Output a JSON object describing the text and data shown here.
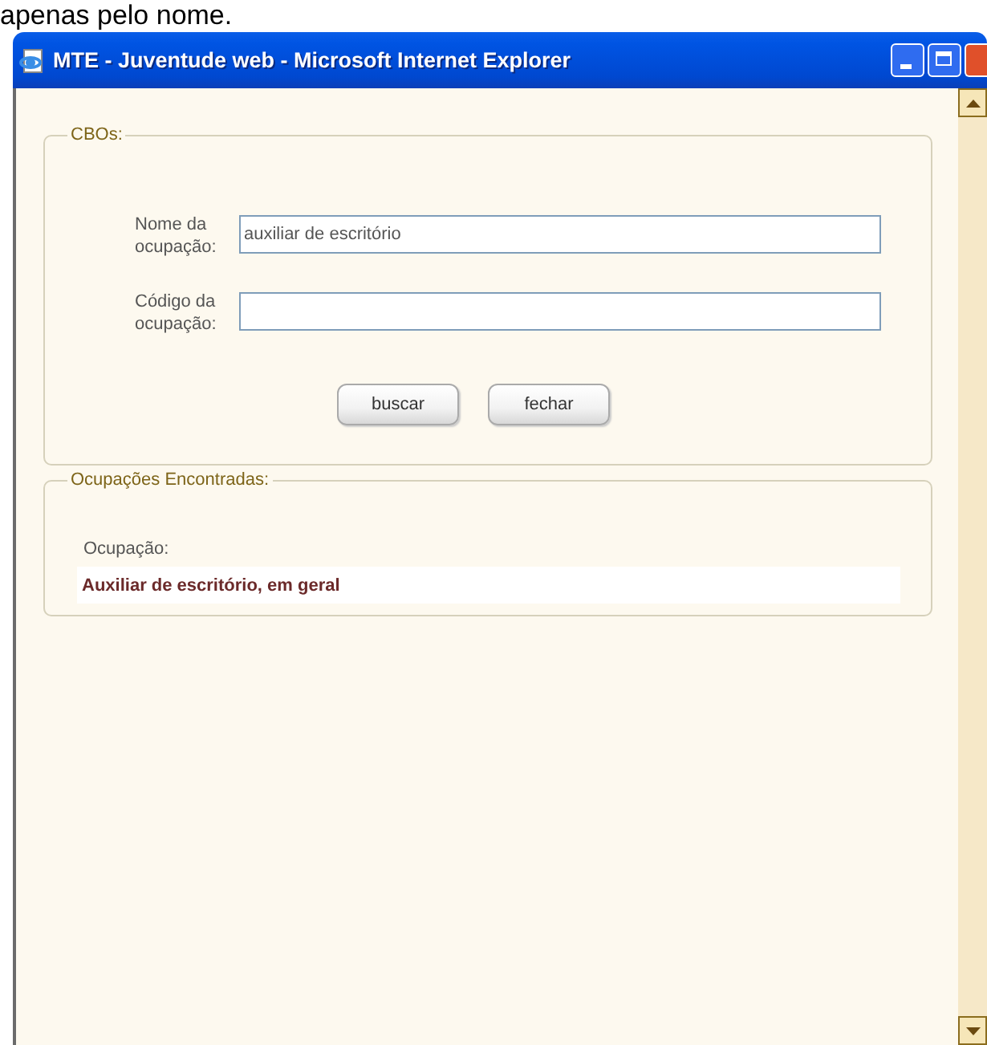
{
  "caption": "apenas pelo nome.",
  "window": {
    "title": "MTE - Juventude web - Microsoft Internet Explorer"
  },
  "search_panel": {
    "legend": "CBOs:",
    "fields": [
      {
        "label": "Nome da ocupação:",
        "value": "auxiliar de escritório"
      },
      {
        "label": "Código da ocupação:"
      }
    ],
    "buttons": [
      "buscar",
      "fechar"
    ]
  },
  "results_panel": {
    "legend": "Ocupações Encontradas:",
    "column": "Ocupação:",
    "rows": [
      "Auxiliar de escritório, em geral"
    ]
  }
}
